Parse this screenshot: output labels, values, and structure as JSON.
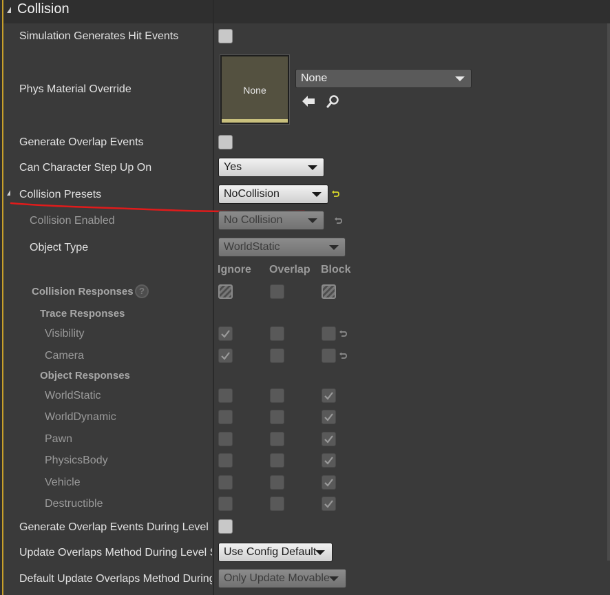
{
  "header": {
    "title": "Collision"
  },
  "rows": {
    "sim_hit": "Simulation Generates Hit Events",
    "phys_material": "Phys Material Override",
    "gen_overlap": "Generate Overlap Events",
    "step_up": "Can Character Step Up On",
    "presets": "Collision Presets",
    "collision_enabled": "Collision Enabled",
    "object_type": "Object Type",
    "responses": "Collision Responses",
    "trace_responses": "Trace Responses",
    "object_responses": "Object Responses",
    "gen_overlap_level": "Generate Overlap Events During Level S",
    "update_overlaps": "Update Overlaps Method During Level S",
    "default_update": "Default Update Overlaps Method During"
  },
  "phys_material": {
    "thumbnail_text": "None",
    "selected": "None",
    "use_icon": "arrow-left-icon",
    "browse_icon": "magnifier-icon"
  },
  "values": {
    "step_up": "Yes",
    "presets": "NoCollision",
    "collision_enabled": "No Collision",
    "object_type": "WorldStatic",
    "update_overlaps": "Use Config Default",
    "default_update": "Only Update Movable"
  },
  "columns": {
    "ignore": "Ignore",
    "overlap": "Overlap",
    "block": "Block"
  },
  "trace_channels": [
    "Visibility",
    "Camera"
  ],
  "object_channels": [
    "WorldStatic",
    "WorldDynamic",
    "Pawn",
    "PhysicsBody",
    "Vehicle",
    "Destructible"
  ],
  "help_glyph": "?",
  "colors": {
    "accent": "#c8a02a",
    "annotation": "#e01b1b",
    "reset_arrow": "#d6d62a"
  }
}
